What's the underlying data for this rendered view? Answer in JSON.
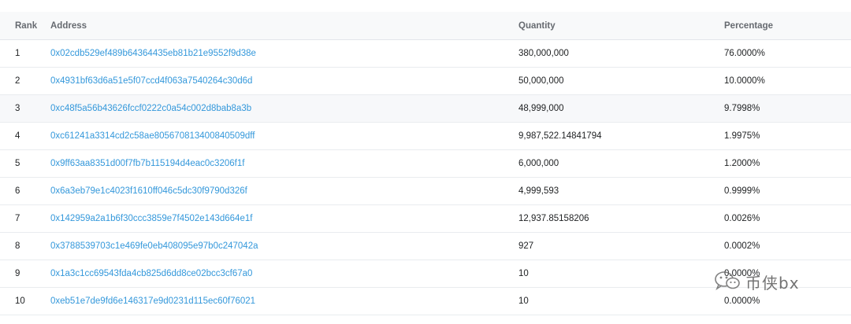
{
  "table": {
    "headers": {
      "rank": "Rank",
      "address": "Address",
      "quantity": "Quantity",
      "percentage": "Percentage"
    },
    "rows": [
      {
        "rank": "1",
        "address": "0x02cdb529ef489b64364435eb81b21e9552f9d38e",
        "quantity": "380,000,000",
        "percentage": "76.0000%"
      },
      {
        "rank": "2",
        "address": "0x4931bf63d6a51e5f07ccd4f063a7540264c30d6d",
        "quantity": "50,000,000",
        "percentage": "10.0000%"
      },
      {
        "rank": "3",
        "address": "0xc48f5a56b43626fccf0222c0a54c002d8bab8a3b",
        "quantity": "48,999,000",
        "percentage": "9.7998%"
      },
      {
        "rank": "4",
        "address": "0xc61241a3314cd2c58ae805670813400840509dff",
        "quantity": "9,987,522.14841794",
        "percentage": "1.9975%"
      },
      {
        "rank": "5",
        "address": "0x9ff63aa8351d00f7fb7b115194d4eac0c3206f1f",
        "quantity": "6,000,000",
        "percentage": "1.2000%"
      },
      {
        "rank": "6",
        "address": "0x6a3eb79e1c4023f1610ff046c5dc30f9790d326f",
        "quantity": "4,999,593",
        "percentage": "0.9999%"
      },
      {
        "rank": "7",
        "address": "0x142959a2a1b6f30ccc3859e7f4502e143d664e1f",
        "quantity": "12,937.85158206",
        "percentage": "0.0026%"
      },
      {
        "rank": "8",
        "address": "0x3788539703c1e469fe0eb408095e97b0c247042a",
        "quantity": "927",
        "percentage": "0.0002%"
      },
      {
        "rank": "9",
        "address": "0x1a3c1cc69543fda4cb825d6dd8ce02bcc3cf67a0",
        "quantity": "10",
        "percentage": "0.0000%"
      },
      {
        "rank": "10",
        "address": "0xeb51e7de9fd6e146317e9d0231d115ec60f76021",
        "quantity": "10",
        "percentage": "0.0000%"
      }
    ],
    "highlighted_row": 3
  },
  "watermark": {
    "text": "币侠bx",
    "icon": "wechat-icon"
  }
}
